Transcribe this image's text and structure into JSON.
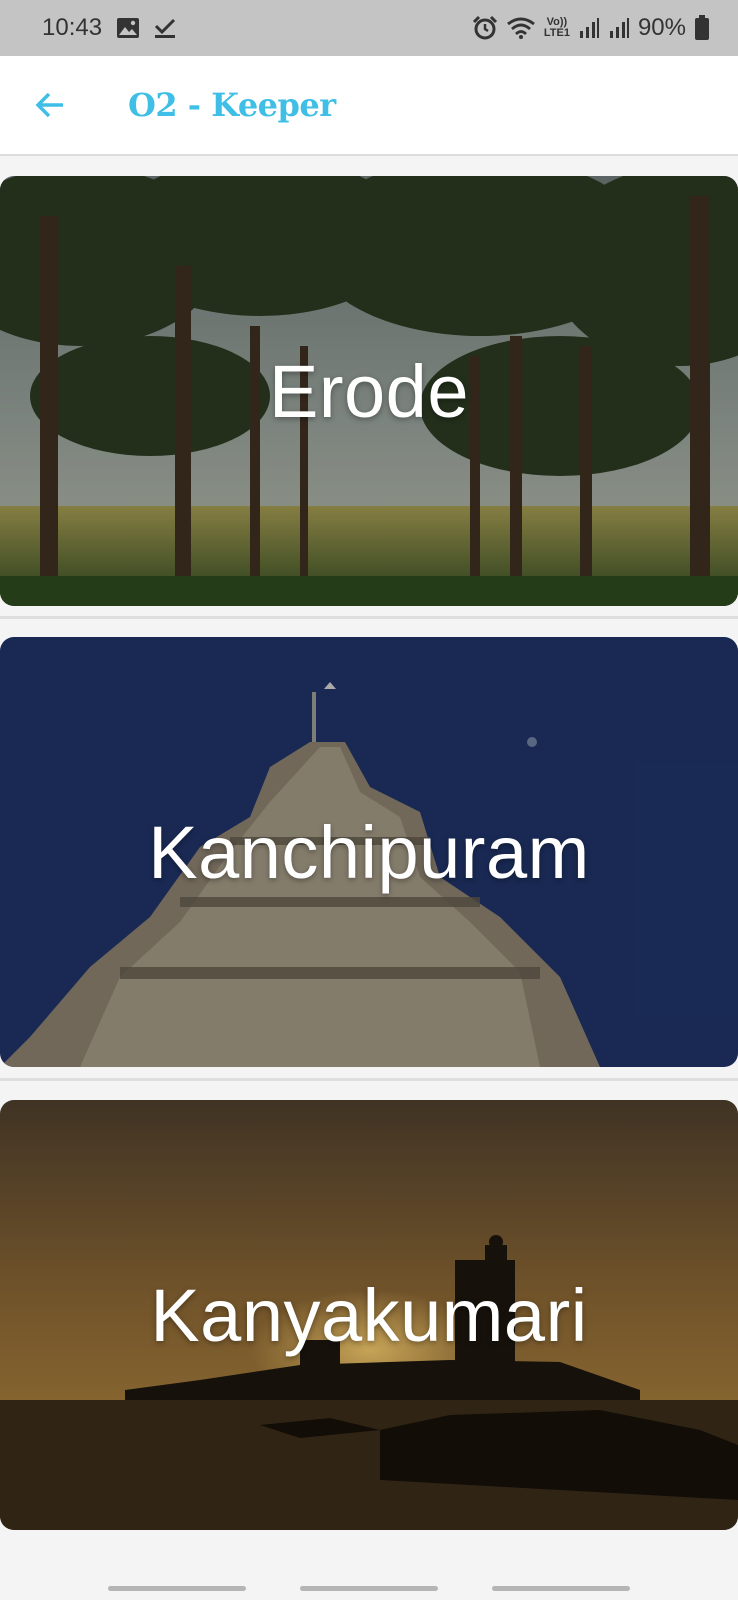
{
  "status_bar": {
    "time": "10:43",
    "battery": "90%",
    "left_icons": [
      "gallery-icon",
      "task-check-icon"
    ],
    "right_icons": [
      "alarm-icon",
      "wifi-icon",
      "volte-icon",
      "signal-icon",
      "signal-icon",
      "battery-icon"
    ],
    "volte_label_top": "Vo))",
    "volte_label_bottom": "LTE1"
  },
  "app_bar": {
    "title": "O2 - Keeper",
    "back_icon": "arrow-left-icon",
    "accent_color": "#3fbfe6"
  },
  "cities": [
    {
      "name": "Erode",
      "image_description_icon": "palm-grove-image"
    },
    {
      "name": "Kanchipuram",
      "image_description_icon": "temple-tower-image"
    },
    {
      "name": "Kanyakumari",
      "image_description_icon": "sunset-coast-image"
    }
  ],
  "colors": {
    "status_bar_bg": "#c4c4c4",
    "app_bar_bg": "#ffffff",
    "page_bg": "#f4f4f4"
  }
}
